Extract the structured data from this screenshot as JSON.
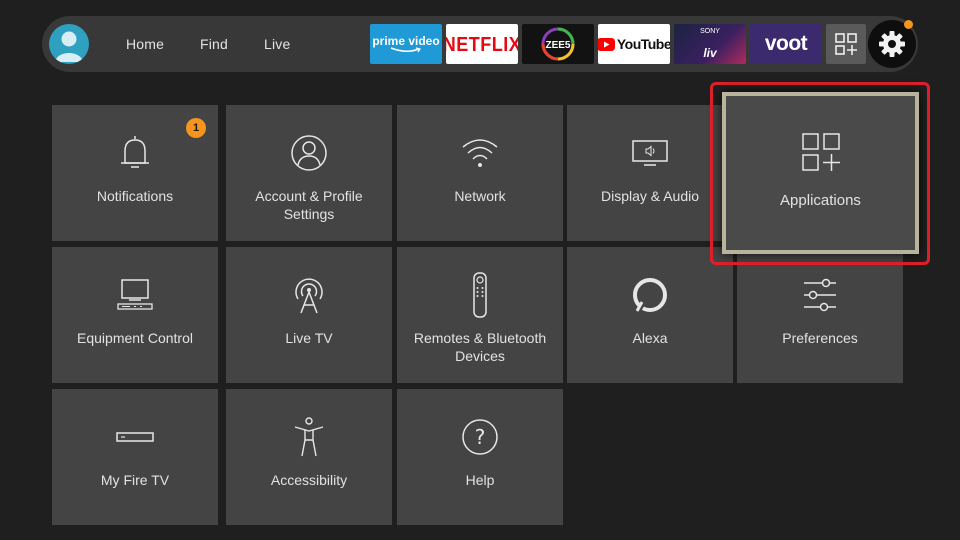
{
  "nav": {
    "home": "Home",
    "find": "Find",
    "live": "Live"
  },
  "apps": {
    "prime_video": "prime video",
    "netflix": "NETFLIX",
    "zee5": "ZEE5",
    "youtube": "YouTube",
    "sonyliv_sony": "SONY",
    "sonyliv_liv": "liv",
    "voot": "voot"
  },
  "icons": {
    "avatar": "profile-avatar-icon",
    "all_apps": "all-apps-icon",
    "settings": "gear-icon"
  },
  "colors": {
    "focus_outline": "#e0202a",
    "badge": "#f7941d",
    "tile": "#444444",
    "prime": "#1f9ad6",
    "netflix": "#e50914",
    "voot": "#3b2a6d"
  },
  "settings_tiles": [
    {
      "label": "Notifications",
      "icon": "bell-icon",
      "badge": "1"
    },
    {
      "label": "Account & Profile Settings",
      "icon": "person-icon"
    },
    {
      "label": "Network",
      "icon": "wifi-icon"
    },
    {
      "label": "Display & Audio",
      "icon": "display-icon"
    },
    {
      "label": "Applications",
      "icon": "apps-icon",
      "focused": true
    },
    {
      "label": "Equipment Control",
      "icon": "tv-equipment-icon"
    },
    {
      "label": "Live TV",
      "icon": "antenna-icon"
    },
    {
      "label": "Remotes & Bluetooth Devices",
      "icon": "remote-icon"
    },
    {
      "label": "Alexa",
      "icon": "alexa-icon"
    },
    {
      "label": "Preferences",
      "icon": "sliders-icon"
    },
    {
      "label": "My Fire TV",
      "icon": "fire-tv-stick-icon"
    },
    {
      "label": "Accessibility",
      "icon": "accessibility-icon"
    },
    {
      "label": "Help",
      "icon": "help-icon"
    }
  ]
}
